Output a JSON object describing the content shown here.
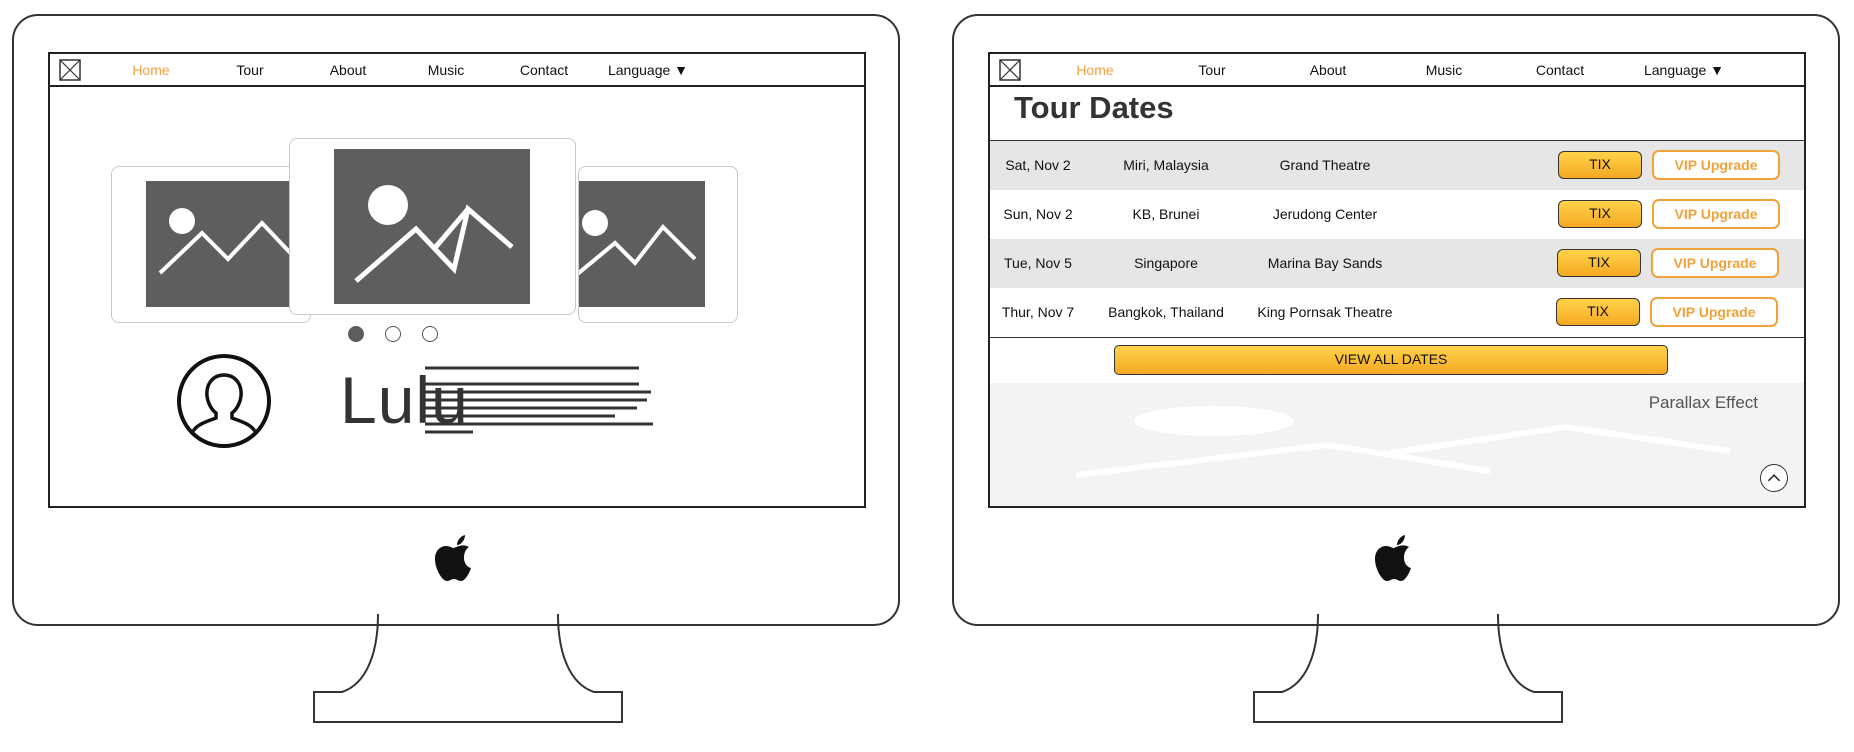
{
  "nav": {
    "items": [
      {
        "label": "Home",
        "active": true
      },
      {
        "label": "Tour",
        "active": false
      },
      {
        "label": "About",
        "active": false
      },
      {
        "label": "Music",
        "active": false
      },
      {
        "label": "Contact",
        "active": false
      }
    ],
    "language_label": "Language ▼"
  },
  "home": {
    "carousel": {
      "slide_count": 3,
      "active_slide": 1
    },
    "artist_name": "Lulu"
  },
  "tour": {
    "title": "Tour Dates",
    "rows": [
      {
        "date": "Sat, Nov 2",
        "location": "Miri, Malaysia",
        "venue": "Grand Theatre",
        "tix_label": "TIX",
        "vip_label": "VIP Upgrade"
      },
      {
        "date": "Sun, Nov 2",
        "location": "KB, Brunei",
        "venue": "Jerudong Center",
        "tix_label": "TIX",
        "vip_label": "VIP Upgrade"
      },
      {
        "date": "Tue, Nov 5",
        "location": "Singapore",
        "venue": "Marina Bay Sands",
        "tix_label": "TIX",
        "vip_label": "VIP Upgrade"
      },
      {
        "date": "Thur, Nov 7",
        "location": "Bangkok, Thailand",
        "venue": "King Pornsak Theatre",
        "tix_label": "TIX",
        "vip_label": "VIP Upgrade"
      }
    ],
    "view_all_label": "VIEW ALL DATES",
    "parallax_label": "Parallax Effect"
  },
  "colors": {
    "accent": "#f2a23a",
    "button_gradient_top": "#ffd34a",
    "button_gradient_bottom": "#f6a823",
    "placeholder": "#5e5e5e"
  }
}
